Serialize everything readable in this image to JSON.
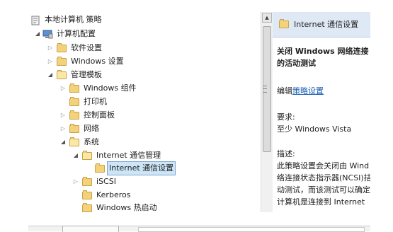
{
  "tree": {
    "root": "本地计算机 策略",
    "computer_config": "计算机配置",
    "software_settings": "软件设置",
    "windows_settings": "Windows 设置",
    "admin_templates": "管理模板",
    "windows_components": "Windows 组件",
    "printers": "打印机",
    "control_panel": "控制面板",
    "network": "网络",
    "system": "系统",
    "internet_comm_mgmt": "Internet 通信管理",
    "internet_comm_settings": "Internet 通信设置",
    "iscsi": "iSCSI",
    "kerberos": "Kerberos",
    "windows_hotstart": "Windows 热启动"
  },
  "detail": {
    "header_title": "Internet 通信设置",
    "policy_title_line1": "关闭 Windows 网络连接",
    "policy_title_line2": "的活动测试",
    "edit_prefix": "编辑",
    "edit_link": "策略设置",
    "requirements_label": "要求:",
    "requirements_value": "至少 Windows Vista",
    "description_label": "描述:",
    "description_line1": "此策略设置会关闭由 Wind",
    "description_line2": "络连接状态指示器(NCSI)拮",
    "description_line3": "动测试，而该测试可以确定",
    "description_line4": "计算机是连接到 Internet"
  }
}
